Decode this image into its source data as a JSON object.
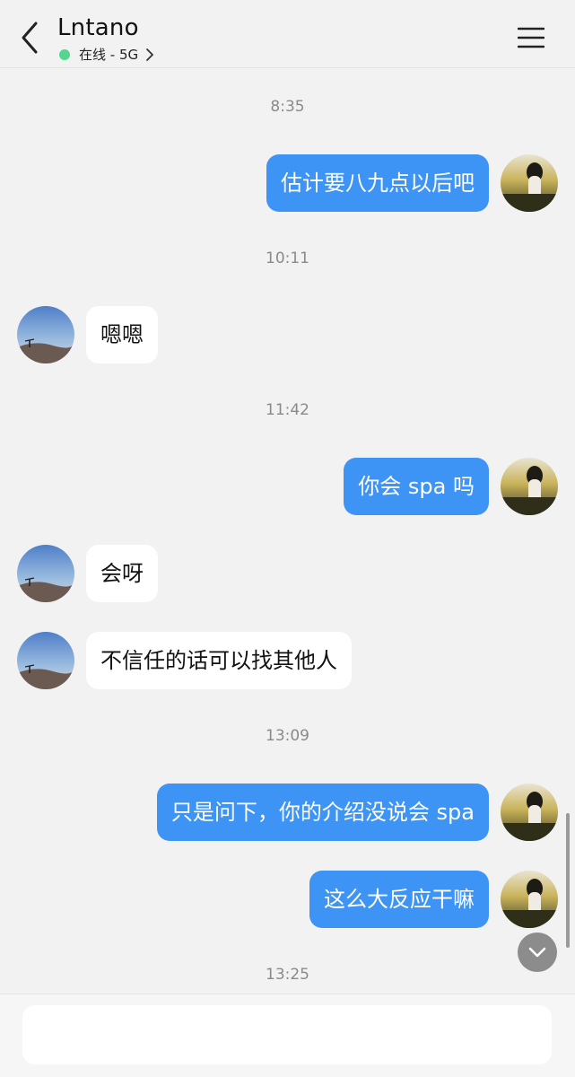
{
  "header": {
    "title": "Lntano",
    "status": "在线 - 5G",
    "status_color": "#54d68f"
  },
  "icons": {
    "back": "chevron-left-icon",
    "menu": "hamburger-menu-icon",
    "status_more": "chevron-right-icon",
    "scroll_down": "chevron-down-icon"
  },
  "colors": {
    "self_bubble": "#3d94f5",
    "other_bubble": "#ffffff",
    "background": "#f2f2f2"
  },
  "messages": {
    "t1": "8:35",
    "m1": "估计要八九点以后吧",
    "t2": "10:11",
    "m2": "嗯嗯",
    "t3": "11:42",
    "m3": "你会 spa 吗",
    "m4": "会呀",
    "m5": "不信任的话可以找其他人",
    "t4": "13:09",
    "m6": "只是问下，你的介绍没说会 spa",
    "m7": "这么大反应干嘛",
    "t5": "13:25"
  },
  "input": {
    "value": "",
    "placeholder": ""
  }
}
